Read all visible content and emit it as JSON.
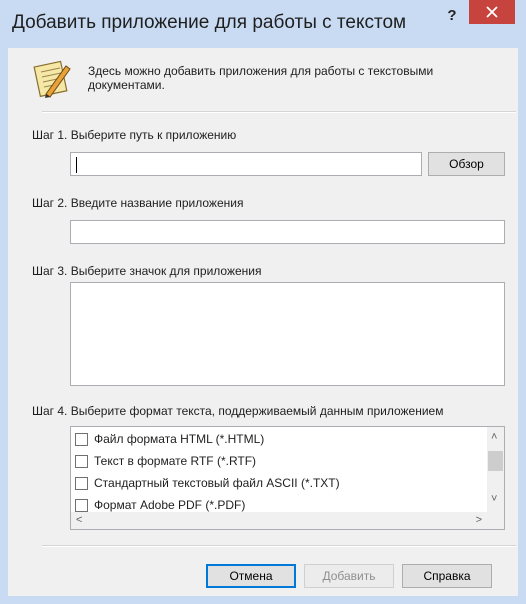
{
  "title": "Добавить приложение для работы с текстом",
  "title_buttons": {
    "help": "?",
    "close": "×"
  },
  "intro": "Здесь можно добавить приложения для работы с текстовыми документами.",
  "steps": {
    "step1": "Шаг 1. Выберите путь к приложению",
    "step2": "Шаг 2. Введите название приложения",
    "step3": "Шаг 3. Выберите значок для приложения",
    "step4": "Шаг 4. Выберите формат текста, поддерживаемый данным приложением"
  },
  "path_input": {
    "value": ""
  },
  "name_input": {
    "value": ""
  },
  "browse_label": "Обзор",
  "formats": [
    {
      "label": "Файл формата HTML (*.HTML)",
      "checked": false
    },
    {
      "label": "Текст в формате RTF (*.RTF)",
      "checked": false
    },
    {
      "label": "Стандартный текстовый файл ASCII (*.TXT)",
      "checked": false
    },
    {
      "label": "Формат Adobe PDF (*.PDF)",
      "checked": false
    }
  ],
  "footer": {
    "cancel": "Отмена",
    "add": "Добавить",
    "help": "Справка"
  },
  "icons": {
    "intro": "notepad-pencil-icon",
    "close": "close-icon",
    "help": "help-icon"
  }
}
